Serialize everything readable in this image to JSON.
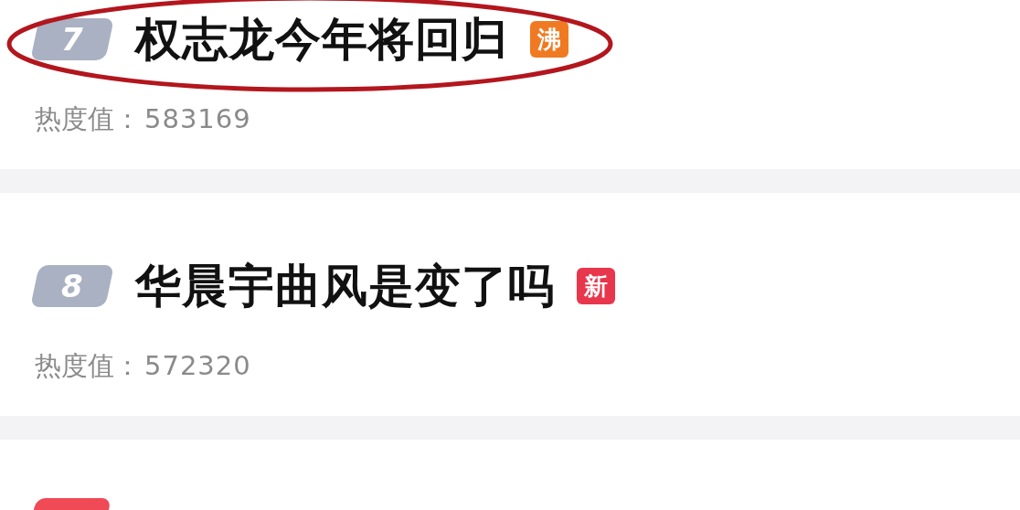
{
  "items": [
    {
      "rank": "7",
      "color": "#a9b1c3",
      "title": "权志龙今年将回归",
      "tag": {
        "text": "沸",
        "color": "#f07a22"
      },
      "heat_label": "热度值：",
      "heat_value": "583169",
      "circled": true
    },
    {
      "rank": "8",
      "color": "#a9b1c3",
      "title": "华晨宇曲风是变了吗",
      "tag": {
        "text": "新",
        "color": "#e8364d"
      },
      "heat_label": "热度值：",
      "heat_value": "572320",
      "circled": false
    }
  ],
  "next_item": {
    "color": "#ef4a55"
  }
}
